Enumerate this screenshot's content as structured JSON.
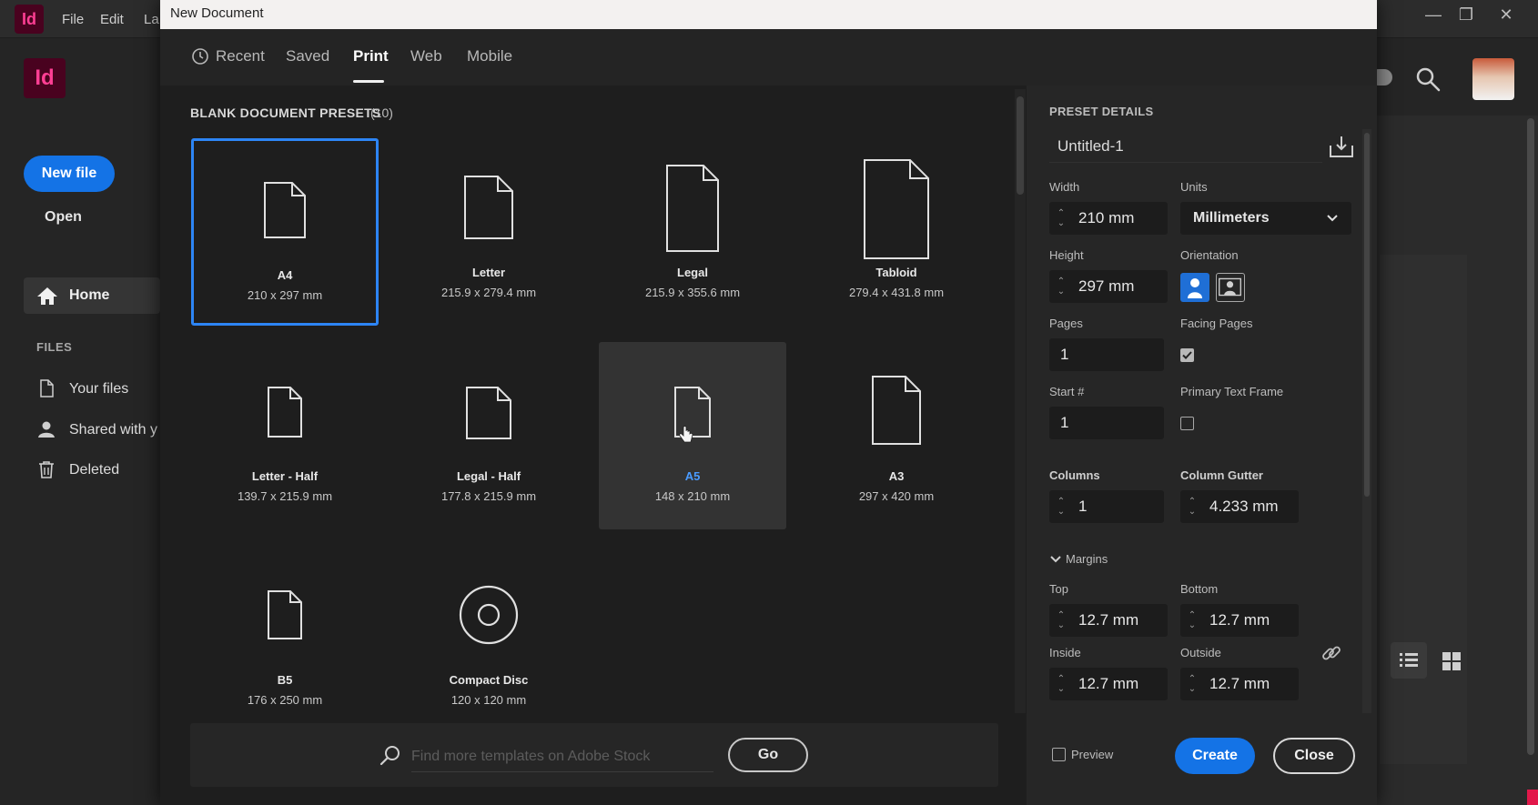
{
  "app": {
    "menu": [
      "File",
      "Edit",
      "La"
    ],
    "logo_text": "Id",
    "new_file_label": "New file",
    "open_label": "Open",
    "home_label": "Home",
    "files_section": "FILES",
    "files_items": [
      "Your files",
      "Shared with y",
      "Deleted"
    ]
  },
  "dialog": {
    "title": "New Document",
    "tabs": [
      "Recent",
      "Saved",
      "Print",
      "Web",
      "Mobile"
    ],
    "active_tab": "Print",
    "presets_title": "BLANK DOCUMENT PRESETS",
    "presets_count": "(10)",
    "presets": [
      {
        "name": "A4",
        "size": "210 x 297 mm",
        "state": "selected"
      },
      {
        "name": "Letter",
        "size": "215.9 x 279.4 mm",
        "state": "normal"
      },
      {
        "name": "Legal",
        "size": "215.9 x 355.6 mm",
        "state": "normal"
      },
      {
        "name": "Tabloid",
        "size": "279.4 x 431.8 mm",
        "state": "normal"
      },
      {
        "name": "Letter - Half",
        "size": "139.7 x 215.9 mm",
        "state": "normal"
      },
      {
        "name": "Legal - Half",
        "size": "177.8 x 215.9 mm",
        "state": "normal"
      },
      {
        "name": "A5",
        "size": "148 x 210 mm",
        "state": "hover"
      },
      {
        "name": "A3",
        "size": "297 x 420 mm",
        "state": "normal"
      },
      {
        "name": "B5",
        "size": "176 x 250 mm",
        "state": "normal"
      },
      {
        "name": "Compact Disc",
        "size": "120 x 120 mm",
        "state": "normal"
      }
    ],
    "search_placeholder": "Find more templates on Adobe Stock",
    "go_label": "Go",
    "details": {
      "title": "PRESET DETAILS",
      "doc_name": "Untitled-1",
      "width_label": "Width",
      "width_value": "210 mm",
      "units_label": "Units",
      "units_value": "Millimeters",
      "height_label": "Height",
      "height_value": "297 mm",
      "orientation_label": "Orientation",
      "orientation_value": "portrait",
      "pages_label": "Pages",
      "pages_value": "1",
      "facing_label": "Facing Pages",
      "facing_checked": true,
      "start_label": "Start #",
      "start_value": "1",
      "primary_label": "Primary Text Frame",
      "primary_checked": false,
      "columns_label": "Columns",
      "columns_value": "1",
      "gutter_label": "Column Gutter",
      "gutter_value": "4.233 mm",
      "margins_label": "Margins",
      "top_label": "Top",
      "top_value": "12.7 mm",
      "bottom_label": "Bottom",
      "bottom_value": "12.7 mm",
      "inside_label": "Inside",
      "inside_value": "12.7 mm",
      "outside_label": "Outside",
      "outside_value": "12.7 mm"
    },
    "preview_label": "Preview",
    "create_label": "Create",
    "close_label": "Close"
  },
  "colors": {
    "accent": "#1473e6",
    "selection": "#2d85f5",
    "brand": "#ff3f94"
  }
}
